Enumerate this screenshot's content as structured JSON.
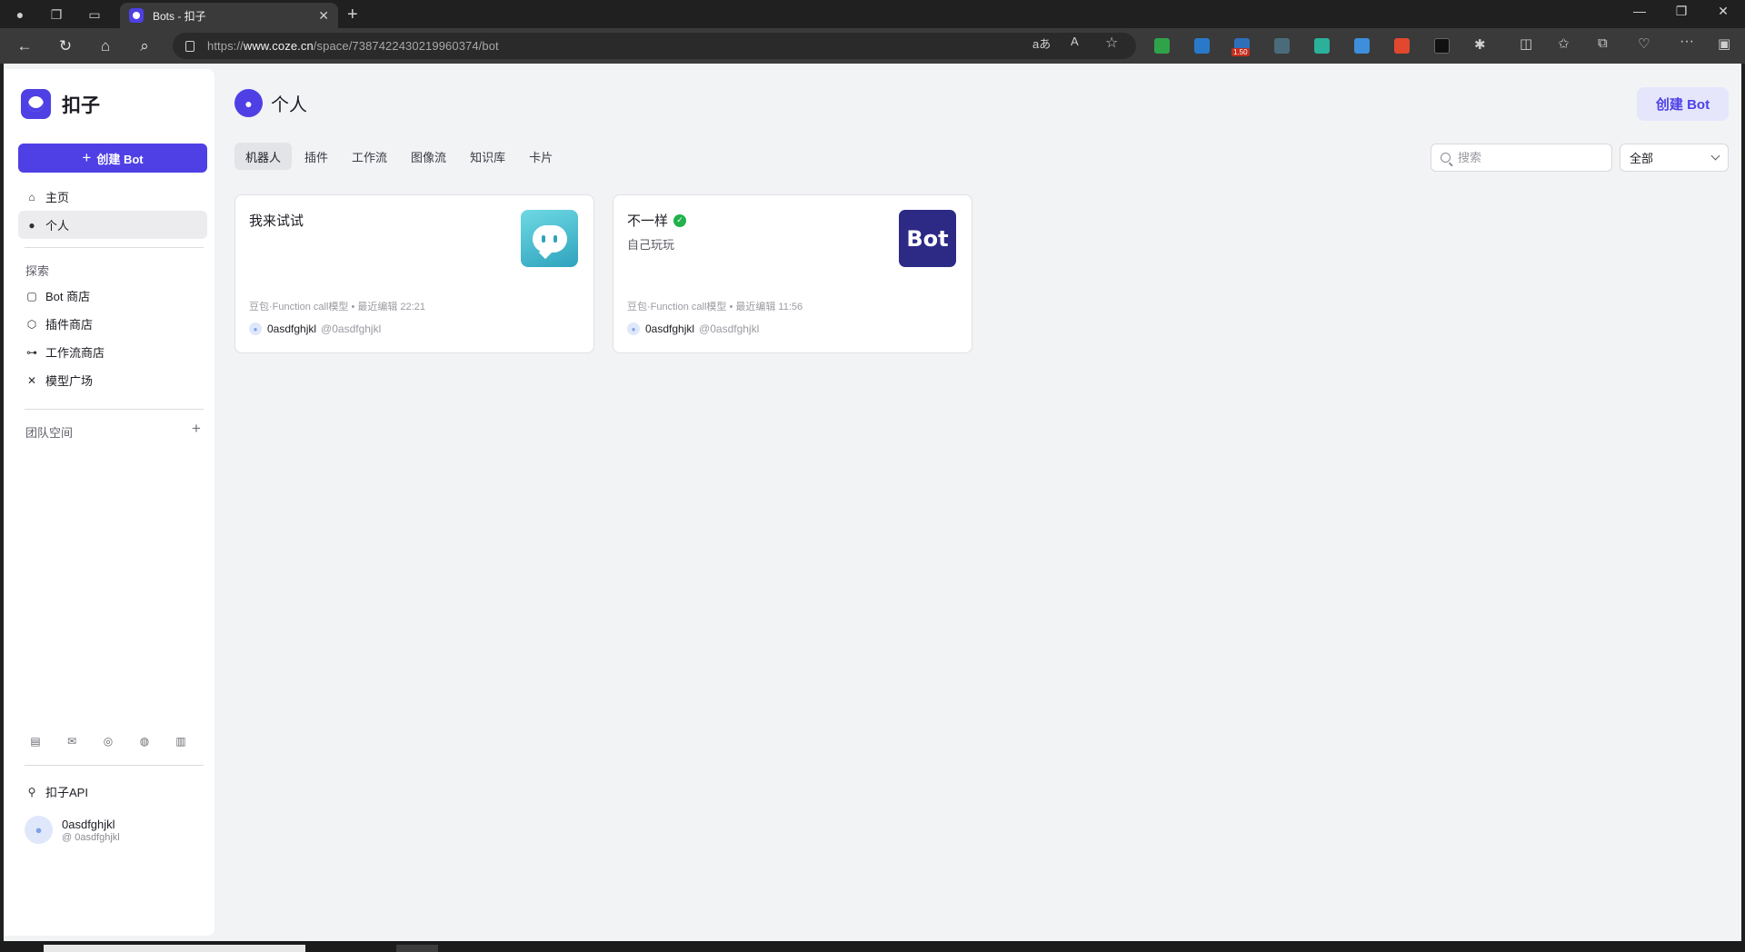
{
  "browser": {
    "tab_title": "Bots - 扣子",
    "url_scheme": "https://",
    "url_host": "www.coze.cn",
    "url_path": "/space/7387422430219960374/bot",
    "ext_badge": "1.50"
  },
  "sidebar": {
    "brand": "扣子",
    "create_label": "创建 Bot",
    "nav": [
      {
        "label": "主页",
        "icon": "home-icon"
      },
      {
        "label": "个人",
        "icon": "person-icon",
        "active": true
      }
    ],
    "explore_title": "探索",
    "explore": [
      {
        "label": "Bot 商店",
        "icon": "bot-icon"
      },
      {
        "label": "插件商店",
        "icon": "cube-icon"
      },
      {
        "label": "工作流商店",
        "icon": "workflow-icon"
      },
      {
        "label": "模型广场",
        "icon": "model-icon"
      }
    ],
    "team_title": "团队空间",
    "api_label": "扣子API",
    "user": {
      "name": "0asdfghjkl",
      "handle": "@ 0asdfghjkl"
    }
  },
  "main": {
    "title": "个人",
    "create_label": "创建 Bot",
    "tabs": [
      "机器人",
      "插件",
      "工作流",
      "图像流",
      "知识库",
      "卡片"
    ],
    "active_tab": 0,
    "search_placeholder": "搜索",
    "filter_value": "全部",
    "cards": [
      {
        "title": "我来试试",
        "description": "",
        "meta": "豆包·Function call模型 • 最近编辑 22:21",
        "author": "0asdfghjkl",
        "handle": "@0asdfghjkl",
        "image": "chat-bubble-icon"
      },
      {
        "title": "不一样",
        "description": "自己玩玩",
        "meta": "豆包·Function call模型 • 最近编辑 11:56",
        "author": "0asdfghjkl",
        "handle": "@0asdfghjkl",
        "image_text": "Bot",
        "published": true
      }
    ]
  },
  "colors": {
    "accent": "#4e40e5",
    "page_bg": "#f2f3f5",
    "published": "#22b14c"
  }
}
